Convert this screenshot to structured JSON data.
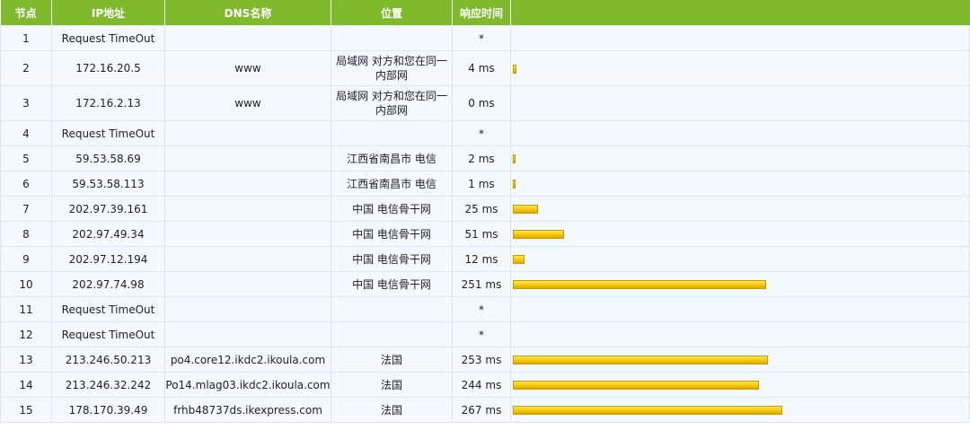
{
  "headers": {
    "node": "节点",
    "ip": "IP地址",
    "dns": "DNS名称",
    "location": "位置",
    "response": "响应时间"
  },
  "max_ms_scale": 267,
  "rows": [
    {
      "node": "1",
      "ip": "Request TimeOut",
      "dns": "",
      "location": "",
      "response": "*",
      "ms": 0
    },
    {
      "node": "2",
      "ip": "172.16.20.5",
      "dns": "www",
      "location": "局域网 对方和您在同一内部网",
      "response": "4 ms",
      "ms": 4
    },
    {
      "node": "3",
      "ip": "172.16.2.13",
      "dns": "www",
      "location": "局域网 对方和您在同一内部网",
      "response": "0 ms",
      "ms": 0
    },
    {
      "node": "4",
      "ip": "Request TimeOut",
      "dns": "",
      "location": "",
      "response": "*",
      "ms": 0
    },
    {
      "node": "5",
      "ip": "59.53.58.69",
      "dns": "",
      "location": "江西省南昌市 电信",
      "response": "2 ms",
      "ms": 2
    },
    {
      "node": "6",
      "ip": "59.53.58.113",
      "dns": "",
      "location": "江西省南昌市 电信",
      "response": "1 ms",
      "ms": 1
    },
    {
      "node": "7",
      "ip": "202.97.39.161",
      "dns": "",
      "location": "中国 电信骨干网",
      "response": "25 ms",
      "ms": 25
    },
    {
      "node": "8",
      "ip": "202.97.49.34",
      "dns": "",
      "location": "中国 电信骨干网",
      "response": "51 ms",
      "ms": 51
    },
    {
      "node": "9",
      "ip": "202.97.12.194",
      "dns": "",
      "location": "中国 电信骨干网",
      "response": "12 ms",
      "ms": 12
    },
    {
      "node": "10",
      "ip": "202.97.74.98",
      "dns": "",
      "location": "中国 电信骨干网",
      "response": "251 ms",
      "ms": 251
    },
    {
      "node": "11",
      "ip": "Request TimeOut",
      "dns": "",
      "location": "",
      "response": "*",
      "ms": 0
    },
    {
      "node": "12",
      "ip": "Request TimeOut",
      "dns": "",
      "location": "",
      "response": "*",
      "ms": 0
    },
    {
      "node": "13",
      "ip": "213.246.50.213",
      "dns": "po4.core12.ikdc2.ikoula.com",
      "location": "法国",
      "response": "253 ms",
      "ms": 253
    },
    {
      "node": "14",
      "ip": "213.246.32.242",
      "dns": "Po14.mlag03.ikdc2.ikoula.com",
      "location": "法国",
      "response": "244 ms",
      "ms": 244
    },
    {
      "node": "15",
      "ip": "178.170.39.49",
      "dns": "frhb48737ds.ikexpress.com",
      "location": "法国",
      "response": "267 ms",
      "ms": 267
    }
  ],
  "colors": {
    "header_bg": "#7fba2c",
    "row_bg": "#f3f9fc",
    "bar_fill": "#f5c400"
  }
}
